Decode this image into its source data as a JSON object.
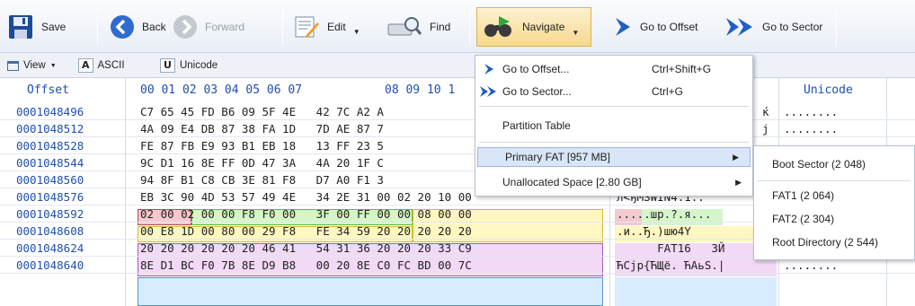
{
  "toolbar": {
    "save": "Save",
    "back": "Back",
    "forward": "Forward",
    "edit": "Edit",
    "find": "Find",
    "navigate": "Navigate",
    "goto_offset": "Go to Offset",
    "goto_sector": "Go to Sector"
  },
  "subbar": {
    "view": "View",
    "ascii_key": "A",
    "ascii": "ASCII",
    "unicode_key": "U",
    "unicode": "Unicode"
  },
  "headers": {
    "offset": "Offset",
    "hex1": "00 01 02 03 04 05 06 07",
    "hex2": "08 09 10 1",
    "unicode": "Unicode"
  },
  "rows": [
    {
      "offset": "0001048496",
      "hex": "C7 65 45 FD B6 09 5F 4E   42 7C A2 A",
      "ascii": "",
      "unicode": "........",
      "tail": "ќ"
    },
    {
      "offset": "0001048512",
      "hex": "4A 09 E4 DB 87 38 FA 1D   7D AE 87 7",
      "ascii": "",
      "unicode": "........",
      "tail": "j"
    },
    {
      "offset": "0001048528",
      "hex": "FE 87 FB E9 93 B1 EB 18   13 FF 23 5",
      "ascii": "",
      "unicode": "........",
      "tail": ""
    },
    {
      "offset": "0001048544",
      "hex": "9C D1 16 8E FF 0D 47 3A   4A 20 1F C",
      "ascii": "",
      "unicode": "........",
      "tail": ""
    },
    {
      "offset": "0001048560",
      "hex": "94 8F B1 C8 CB 3E 81 F8   D7 A0 F1 3",
      "ascii": "",
      "unicode": "........",
      "tail": ""
    },
    {
      "offset": "0001048576",
      "hex": "EB 3C 90 4D 53 57 49 4E   34 2E 31 00 02 20 10 00",
      "ascii": "л<ђMSWIN4.1..",
      "unicode": "........",
      "tail": ""
    },
    {
      "offset": "0001048592",
      "hex": "02 00 02 00 00 F8 F0 00   3F 00 FF 00 00 08 00 00",
      "ascii": ".....шр.?.я...",
      "unicode": "........",
      "tail": ""
    },
    {
      "offset": "0001048608",
      "hex": "00 E8 1D 00 80 00 29 F8   FE 34 59 20 20 20 20 20",
      "ascii": ".и..Ђ.)шю4Y",
      "unicode": "........",
      "tail": ""
    },
    {
      "offset": "0001048624",
      "hex": "20 20 20 20 20 20 46 41   54 31 36 20 20 20 33 C9",
      "ascii": "      FAT16   3Й",
      "unicode": "†††...†.",
      "tail": ""
    },
    {
      "offset": "0001048640",
      "hex": "8E D1 BC F0 7B 8E D9 B8   00 20 8E C0 FC BD 00 7C",
      "ascii": "ЋСјр{ЋЩё. ЋАьЅ.|",
      "unicode": "........",
      "tail": ""
    }
  ],
  "menu": {
    "goto_offset": "Go to Offset...",
    "goto_offset_sc": "Ctrl+Shift+G",
    "goto_sector": "Go to Sector...",
    "goto_sector_sc": "Ctrl+G",
    "partition_table": "Partition Table",
    "primary_fat": "Primary FAT [957 MB]",
    "unallocated": "Unallocated Space [2.80 GB]"
  },
  "submenu": {
    "boot_sector": "Boot Sector (2 048)",
    "fat1": "FAT1 (2 064)",
    "fat2": "FAT2 (2 304)",
    "root_dir": "Root Directory (2 544)"
  },
  "colors": {
    "accent": "#1f4fb0",
    "boot_hl": "#f2c9cf",
    "green_hl": "#d6f5c8",
    "yellow_hl": "#fff7c2",
    "purple_hl": "#f2d9f5",
    "blue_hl": "#d8ecff",
    "menu_hover": "#d9e6f7"
  }
}
